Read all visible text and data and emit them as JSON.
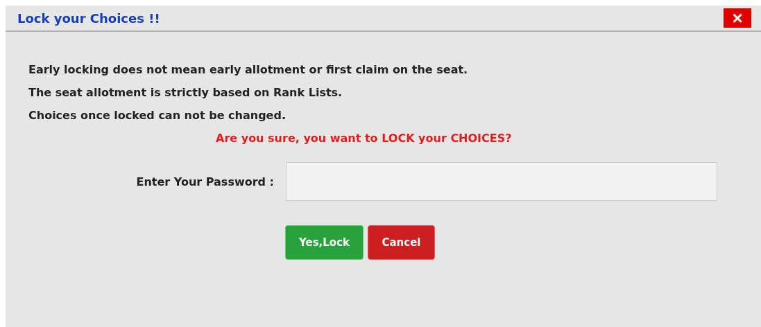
{
  "dialog": {
    "title": "Lock your Choices !!",
    "close": "×"
  },
  "messages": [
    "Early locking does not mean early allotment or first claim on the seat.",
    "The seat allotment is strictly based on Rank Lists.",
    "Choices once locked can not be changed."
  ],
  "warning": "Are you sure, you want to LOCK your CHOICES?",
  "password": {
    "label": "Enter Your Password :"
  },
  "buttons": [
    {
      "label": "Yes,Lock",
      "kind": "confirm"
    },
    {
      "label": "Cancel",
      "kind": "cancel"
    }
  ]
}
